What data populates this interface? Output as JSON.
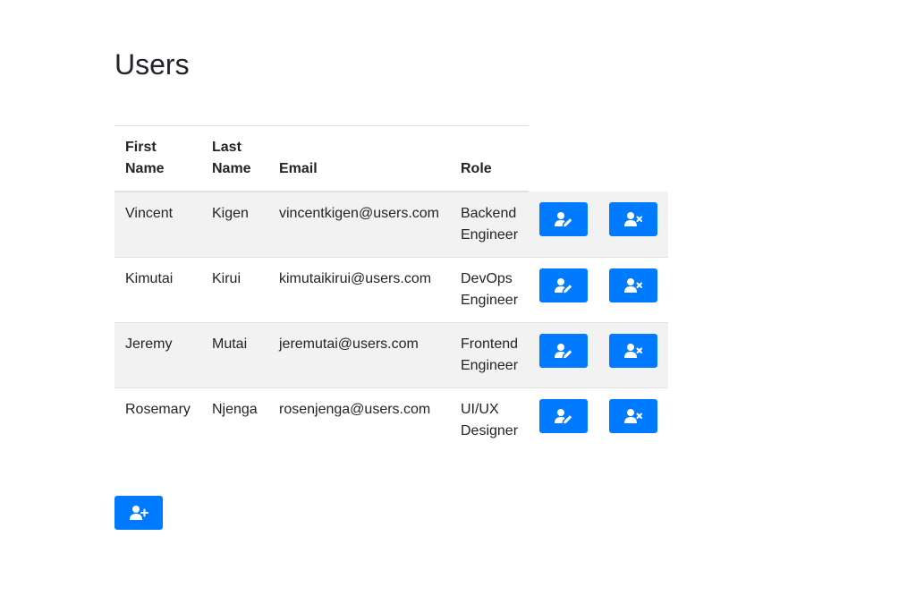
{
  "page": {
    "title": "Users"
  },
  "table": {
    "headers": {
      "first_name": "First Name",
      "last_name": "Last Name",
      "email": "Email",
      "role": "Role"
    },
    "rows": [
      {
        "first_name": "Vincent",
        "last_name": "Kigen",
        "email": "vincentkigen@users.com",
        "role": "Backend Engineer"
      },
      {
        "first_name": "Kimutai",
        "last_name": "Kirui",
        "email": "kimutaikirui@users.com",
        "role": "DevOps Engineer"
      },
      {
        "first_name": "Jeremy",
        "last_name": "Mutai",
        "email": "jeremutai@users.com",
        "role": "Frontend Engineer"
      },
      {
        "first_name": "Rosemary",
        "last_name": "Njenga",
        "email": "rosenjenga@users.com",
        "role": "UI/UX Designer"
      }
    ],
    "row_actions": {
      "edit_icon": "user-edit-icon",
      "delete_icon": "user-remove-icon"
    }
  },
  "add_button": {
    "icon": "user-plus-icon"
  },
  "colors": {
    "primary": "#007bff",
    "stripe": "#f2f2f2",
    "border": "#dee2e6",
    "text": "#212529"
  }
}
